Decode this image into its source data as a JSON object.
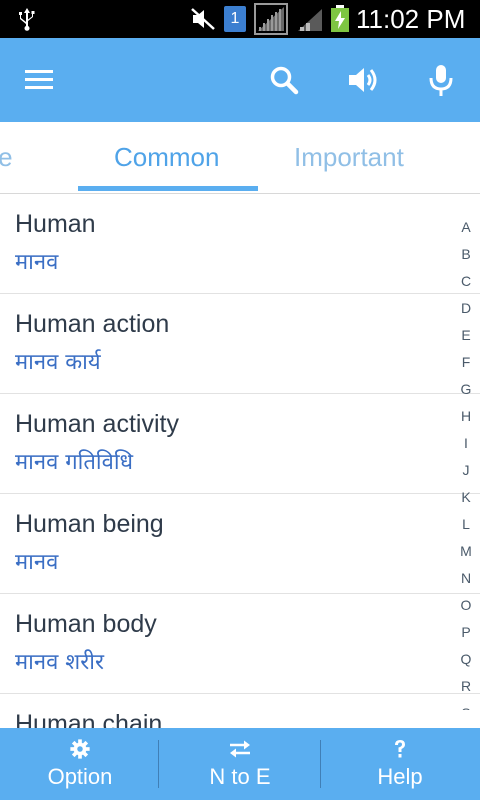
{
  "status_bar": {
    "time": "11:02 PM",
    "sim_slot": "1"
  },
  "app_bar": {
    "icons": [
      "menu-icon",
      "search-icon",
      "speaker-icon",
      "mic-icon"
    ],
    "color": "#5aaef0"
  },
  "tabs": [
    {
      "label": "Home",
      "visible_text": "ome"
    },
    {
      "label": "Common",
      "selected": true
    },
    {
      "label": "Important"
    }
  ],
  "words": [
    {
      "english": "Human",
      "hindi": "मानव"
    },
    {
      "english": "Human action",
      "hindi": "मानव कार्य"
    },
    {
      "english": "Human activity",
      "hindi": "मानव गतिविधि"
    },
    {
      "english": "Human being",
      "hindi": "मानव"
    },
    {
      "english": "Human body",
      "hindi": "मानव शरीर"
    },
    {
      "english": "Human chain",
      "hindi": ""
    }
  ],
  "alphabet": [
    "A",
    "B",
    "C",
    "D",
    "E",
    "F",
    "G",
    "H",
    "I",
    "J",
    "K",
    "L",
    "M",
    "N",
    "O",
    "P",
    "Q",
    "R",
    "S"
  ],
  "bottom_bar": {
    "option": {
      "label": "Option",
      "icon": "gear-icon"
    },
    "n_to_e": {
      "label": "N to E",
      "icon": "swap-arrows-icon"
    },
    "help": {
      "label": "Help",
      "icon": "question-icon"
    }
  },
  "colors": {
    "accent": "#5aaef0",
    "tab_selected": "#4fa3e8",
    "hindi_text": "#3a6ec4",
    "english_text": "#2f3b4a"
  }
}
